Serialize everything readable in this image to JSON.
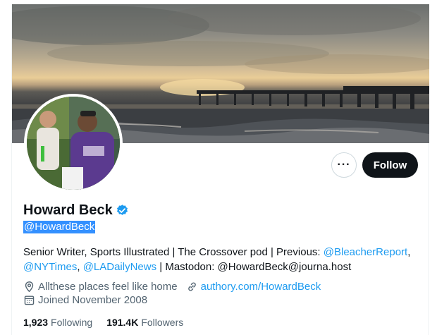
{
  "profile": {
    "display_name": "Howard Beck",
    "handle": "@HowardBeck",
    "verified": true,
    "follow_label": "Follow",
    "more_label": "···"
  },
  "bio": {
    "text_1": "Senior Writer, Sports Illustrated | The Crossover pod | Previous: ",
    "link_bleacher": "@BleacherReport",
    "sep_1": ",",
    "link_nyt": "@NYTimes",
    "sep_2": ", ",
    "link_ladn": "@LADailyNews",
    "text_2": " | Mastodon: @HowardBeck@journa.host"
  },
  "meta": {
    "location": "Allthese places feel like home",
    "website": "authory.com/HowardBeck",
    "joined": "Joined November 2008"
  },
  "stats": {
    "following_count": "1,923",
    "following_label": "Following",
    "followers_count": "191.4K",
    "followers_label": "Followers"
  },
  "colors": {
    "accent": "#1d9bf0",
    "follow_bg": "#0f1419",
    "muted": "#536471"
  },
  "icons": {
    "location": "location-pin-icon",
    "website": "link-icon",
    "joined": "calendar-icon",
    "verified": "verified-badge-icon",
    "more": "more-icon"
  }
}
